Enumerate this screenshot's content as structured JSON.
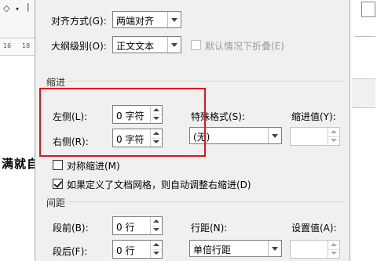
{
  "background": {
    "ruler_numbers": [
      "16",
      "18"
    ],
    "doc_text": "满就自",
    "ribbon_icons": [
      "paint-bucket-icon",
      "dropdown-arrow-icon"
    ]
  },
  "dialog": {
    "general": {
      "alignment_label": "对齐方式(G):",
      "alignment_value": "两端对齐",
      "outline_label": "大纲级别(O):",
      "outline_value": "正文文本",
      "collapse_label": "默认情况下折叠(E)"
    },
    "indent": {
      "section_title": "缩进",
      "left_label": "左侧(L):",
      "left_value": "0 字符",
      "right_label": "右侧(R):",
      "right_value": "0 字符",
      "special_label": "特殊格式(S):",
      "special_value": "(无)",
      "indent_by_label": "缩进值(Y):",
      "indent_by_value": "",
      "mirror_label": "对称缩进(M)",
      "auto_adjust_label": "如果定义了文档网格，则自动调整右缩进(D)"
    },
    "spacing": {
      "section_title": "间距",
      "before_label": "段前(B):",
      "before_value": "0 行",
      "after_label": "段后(F):",
      "after_value": "0 行",
      "line_spacing_label": "行距(N):",
      "line_spacing_value": "单倍行距",
      "at_label": "设置值(A):",
      "at_value": ""
    }
  },
  "colors": {
    "highlight": "#e0141b",
    "dialog_bg": "#f0f0f0"
  }
}
